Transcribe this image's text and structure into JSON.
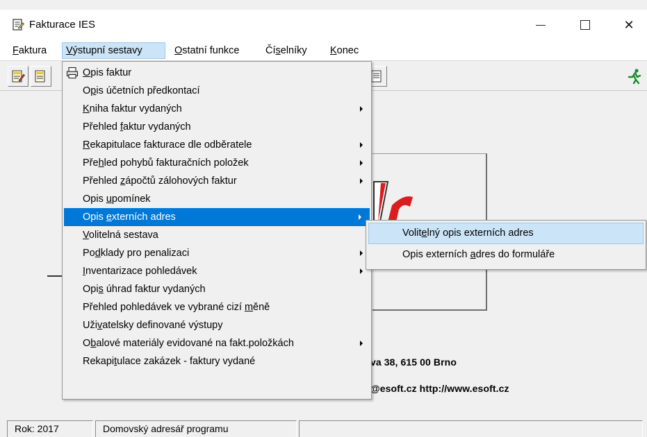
{
  "window": {
    "title": "Fakturace IES",
    "minimize_icon": "minimize-icon",
    "maximize_icon": "maximize-icon",
    "close_icon": "close-icon",
    "close_glyph": "✕"
  },
  "menubar": {
    "items": [
      {
        "label": "Faktura",
        "accel": "F"
      },
      {
        "label": "Výstupní sestavy",
        "accel": "V"
      },
      {
        "label": "Ostatní funkce",
        "accel": "O"
      },
      {
        "label": "Číselníky",
        "accel": "s"
      },
      {
        "label": "Konec",
        "accel": "K"
      }
    ]
  },
  "toolbar": {
    "icons": [
      "invoice-edit-icon",
      "invoice-list-icon",
      "report-icon",
      "exit-runner-icon"
    ]
  },
  "dropdown": {
    "items": [
      {
        "label": "Opis faktur",
        "accel": "O",
        "icon": "printer-icon",
        "submenu": false
      },
      {
        "label": "Opis účetních předkontací",
        "accel": "p",
        "submenu": false
      },
      {
        "label": "Kniha faktur vydaných",
        "accel": "K",
        "submenu": true
      },
      {
        "label": "Přehled faktur vydaných",
        "accel": "f",
        "submenu": false
      },
      {
        "label": "Rekapitulace fakturace dle odběratele",
        "accel": "R",
        "submenu": true
      },
      {
        "label": "Přehled pohybů fakturačních položek",
        "accel": "h",
        "submenu": true
      },
      {
        "label": "Přehled zápočtů zálohových faktur",
        "accel": "z",
        "submenu": true
      },
      {
        "label": "Opis upomínek",
        "accel": "u",
        "submenu": false
      },
      {
        "label": "Opis externích adres",
        "accel": "e",
        "submenu": true,
        "highlighted": true
      },
      {
        "label": "Volitelná sestava",
        "accel": "V",
        "submenu": false
      },
      {
        "label": "Podklady pro penalizaci",
        "accel": "d",
        "submenu": true
      },
      {
        "label": "Inventarizace pohledávek",
        "accel": "I",
        "submenu": true
      },
      {
        "label": "Opis úhrad faktur vydaných",
        "accel": "s",
        "submenu": false
      },
      {
        "label": "Přehled pohledávek ve vybrané cizí měně",
        "accel": "m",
        "submenu": false
      },
      {
        "label": "Uživatelsky definované výstupy",
        "accel": "v",
        "submenu": false
      },
      {
        "label": "Obalové materiály evidované na fakt.položkách",
        "accel": "b",
        "submenu": true
      },
      {
        "label": "Rekapitulace zakázek - faktury vydané",
        "accel": "t",
        "submenu": false
      }
    ]
  },
  "submenu": {
    "items": [
      {
        "label": "Volitelný opis externích adres",
        "accel": "e",
        "highlighted": true
      },
      {
        "label": "Opis externích adres do formuláře",
        "accel": "a"
      }
    ]
  },
  "content": {
    "address": "va 38, 615 00 Brno",
    "contact": "@esoft.cz  http://www.esoft.cz"
  },
  "statusbar": {
    "year": "Rok: 2017",
    "directory": "Domovský adresář programu"
  },
  "colors": {
    "menu_highlight": "#0078d7",
    "menubar_highlight": "#cce4f7",
    "logo_red": "#d81e1e"
  }
}
